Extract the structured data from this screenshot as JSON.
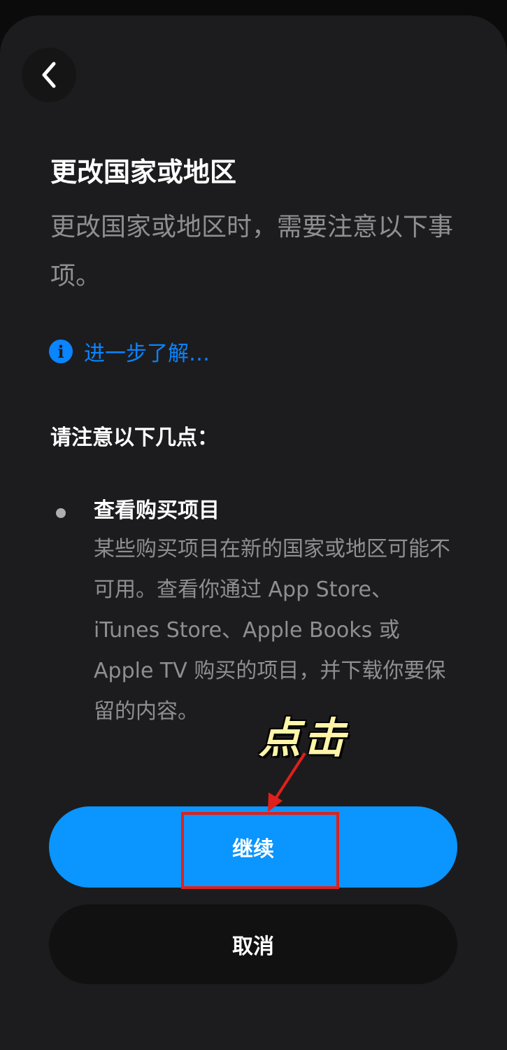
{
  "header": {
    "back_icon": "chevron-left-icon"
  },
  "content": {
    "title": "更改国家或地区",
    "subtitle": "更改国家或地区时，需要注意以下事项。",
    "learn_more": {
      "icon": "info-icon",
      "icon_glyph": "i",
      "label": "进一步了解…"
    },
    "notice_heading": "请注意以下几点：",
    "items": [
      {
        "title": "查看购买项目",
        "description": "某些购买项目在新的国家或地区可能不可用。查看你通过 App Store、iTunes Store、Apple Books 或 Apple TV 购买的项目，并下载你要保留的内容。"
      }
    ]
  },
  "annotation": {
    "label": "点击",
    "color": "#e0201b"
  },
  "actions": {
    "continue_label": "继续",
    "cancel_label": "取消"
  },
  "colors": {
    "accent": "#0a95ff",
    "link": "#0a84ff",
    "background": "#1c1c1e"
  }
}
